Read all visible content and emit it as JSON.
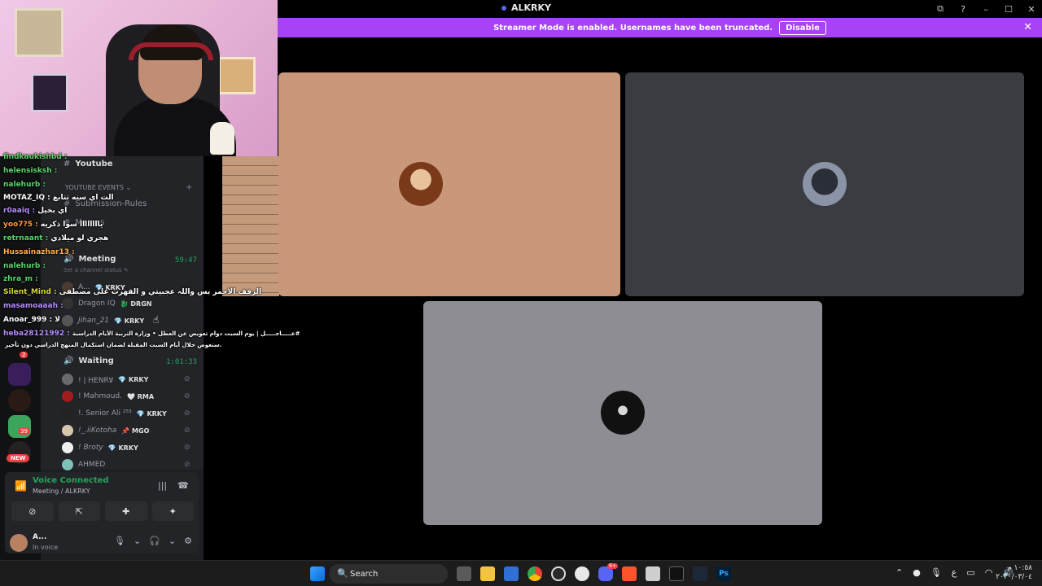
{
  "window": {
    "title": "ALKRKY",
    "controls": [
      "⧉",
      "?",
      "–",
      "☐",
      "✕"
    ]
  },
  "banner": {
    "text": "Streamer Mode is enabled. Usernames have been truncated.",
    "button": "Disable",
    "close": "✕"
  },
  "channels": {
    "items": [
      {
        "label": "Youtube",
        "icon": "#"
      },
      {
        "label": "YOUTUBE EVENTS ⌄",
        "icon": "",
        "add": "+"
      },
      {
        "label": "Submission-Rules",
        "icon": "#"
      },
      {
        "label": "Memes",
        "icon": "#"
      },
      {
        "label": "Meeting",
        "icon": "🔊",
        "timer": "59:47",
        "status": "Set a channel status ✎"
      },
      {
        "label": "Waiting",
        "icon": "🔊",
        "timer": "1:01:33"
      }
    ],
    "meeting_members": [
      {
        "name": "A...",
        "tag": "💎 KRKY"
      },
      {
        "name": "Dragon IQ",
        "tag": "🐉 DRGN"
      },
      {
        "name": "Jihan_21",
        "tag": "💎 KRKY"
      }
    ],
    "waiting_members": [
      {
        "name": "! | HENRꝞ",
        "tag": "💎 KRKY"
      },
      {
        "name": "! Mahmoud.",
        "tag": "🤍 RMA"
      },
      {
        "name": "!. Senior Ali ²⁵³",
        "tag": "💎 KRKY"
      },
      {
        "name": "!_.iiKotoha",
        "tag": "📌 MGO"
      },
      {
        "name": "! Broty",
        "tag": "💎 KRKY"
      },
      {
        "name": "AHMED",
        "tag": ""
      }
    ]
  },
  "server_badges": {
    "b1": "2",
    "b2": "39",
    "b3": "NEW"
  },
  "voice": {
    "status": "Voice Connected",
    "location": "Meeting / ALKRKY",
    "buttons": [
      "⊘",
      "⇱",
      "✚",
      "✦"
    ]
  },
  "user": {
    "name": "A...",
    "status": "In voice"
  },
  "chat": [
    {
      "name": "findkaukishbd :",
      "msg": "",
      "color": "#5bd46a"
    },
    {
      "name": "helensisksh :",
      "msg": "",
      "color": "#5bd46a"
    },
    {
      "name": "nalehurb :",
      "msg": "",
      "color": "#5bd46a"
    },
    {
      "name": "MOTAZ_IQ :",
      "msg": "الت اي سنه تتابع",
      "color": "#ffffff"
    },
    {
      "name": "r0aaiq :",
      "msg": "اي بخيل",
      "color": "#b58cff"
    },
    {
      "name": "yoo7?5 :",
      "msg": "ياااااااا سوا ذكريه",
      "color": "#ff9a3c"
    },
    {
      "name": "retrnaant :",
      "msg": "هجري لو ميلادي",
      "color": "#5bd46a"
    },
    {
      "name": "Hussainazhar13 :",
      "msg": "",
      "color": "#ffb14a"
    },
    {
      "name": "nalehurb :",
      "msg": "",
      "color": "#5bd46a"
    },
    {
      "name": "zhra_m :",
      "msg": "",
      "color": "#5bd46a"
    },
    {
      "name": "Silent_Mind :",
      "msg": "الزفف الاحمر بس واللہ عجبيتي و القهرت على مصطفى",
      "color": "#d6d645"
    },
    {
      "name": "masamoaaah :",
      "msg": "",
      "color": "#b58cff"
    },
    {
      "name": "Anoar_999 :",
      "msg": "لا",
      "color": "#ffffff"
    },
    {
      "name": "heba28121992 :",
      "msg": "عـــــاجـــــل | يوم السبت دوام تعويض عن العطل • وزارة التربية الأيام الدراسية#",
      "color": "#b58cff"
    },
    {
      "name": "",
      "msg": "ستعوض خلال أيام السبت المقبلة لضمان استكمال المنهج الدراسي دون تأخير.",
      "color": "#ffffff"
    }
  ],
  "taskbar": {
    "search": "Search",
    "tray_time": "١٠:٥٨ م",
    "tray_date": "٢٠٢٠/٠٣/٠٤",
    "lang": "ع",
    "discord_badge": "9+"
  },
  "colors": {
    "accent": "#5865f2",
    "banner": "#a742f5",
    "voice_green": "#23a55a"
  }
}
